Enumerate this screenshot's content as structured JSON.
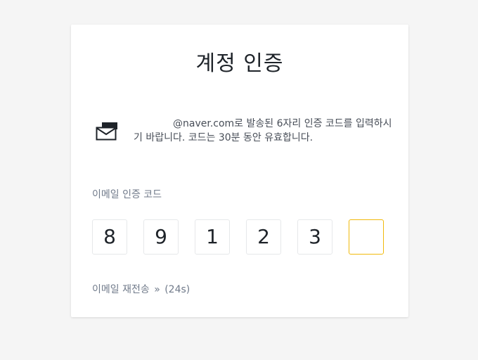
{
  "card": {
    "title": "계정 인증",
    "message_email_domain": "@naver.com",
    "message_rest": "로 발송된 6자리 인증 코드를 입력하시기 바랍니다. 코드는 30분 동안 유효합니다.",
    "code_label": "이메일 인증 코드",
    "code_digits": [
      "8",
      "9",
      "1",
      "2",
      "3",
      ""
    ],
    "resend_label": "이메일 재전송",
    "resend_arrow": "»",
    "resend_timer": "(24s)"
  },
  "colors": {
    "active_border": "#f0b90b",
    "box_border": "#e6e8ea",
    "text_primary": "#1e2329",
    "text_secondary": "#707a8a"
  },
  "icons": {
    "mail": "envelope-icon"
  }
}
